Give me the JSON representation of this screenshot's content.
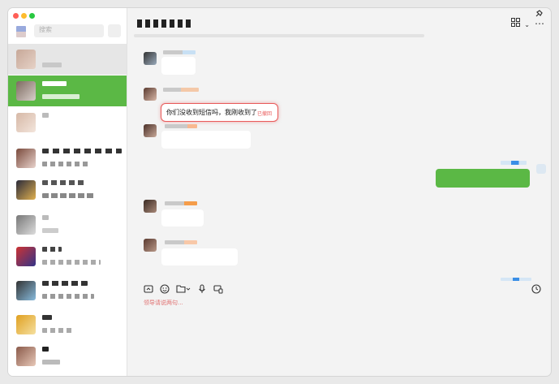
{
  "window": {
    "controls": [
      "close",
      "minimize",
      "zoom"
    ]
  },
  "sidebar": {
    "search_placeholder": "搜索",
    "add_label": "+",
    "selected_index": 1
  },
  "chat": {
    "header_icons": [
      "grid-icon",
      "chevron-down-icon",
      "more-icon"
    ],
    "pin_icon": "pin-icon",
    "recalled_message": {
      "text": "你们没收到短信吗，我刚收到了",
      "status": "已撤回"
    },
    "toolbar": [
      "folder-icon",
      "emoji-icon",
      "file-icon",
      "mic-icon",
      "screen-icon"
    ],
    "input_hint": "领导请说两句...",
    "history_icon": "clock-icon"
  },
  "colors": {
    "accent": "#5bb845",
    "recall": "#e95a5a"
  }
}
